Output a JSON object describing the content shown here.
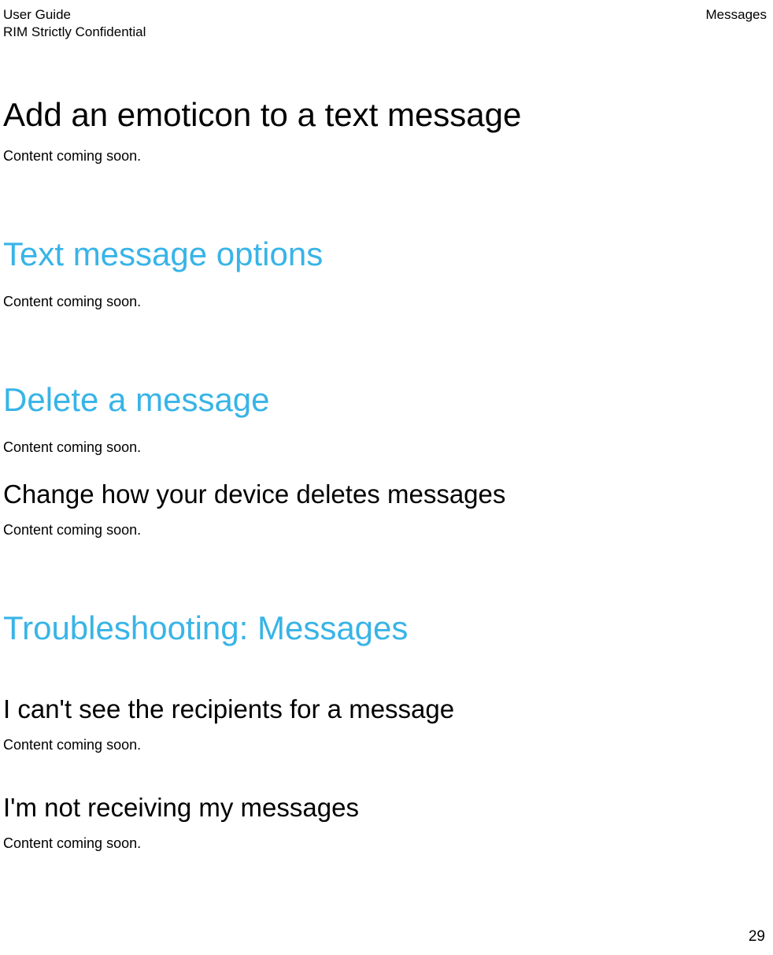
{
  "header": {
    "left1": "User Guide",
    "left2": "RIM Strictly Confidential",
    "right": "Messages"
  },
  "sections": {
    "s1": {
      "title": "Add an emoticon to a text message",
      "body": "Content coming soon."
    },
    "s2": {
      "title": "Text message options",
      "body": "Content coming soon."
    },
    "s3": {
      "title": "Delete a message",
      "body": "Content coming soon.",
      "sub": {
        "title": "Change how your device deletes messages",
        "body": "Content coming soon."
      }
    },
    "s4": {
      "title": "Troubleshooting: Messages",
      "sub1": {
        "title": "I can't see the recipients for a message",
        "body": "Content coming soon."
      },
      "sub2": {
        "title": "I'm not receiving my messages",
        "body": "Content coming soon."
      }
    }
  },
  "page_number": "29"
}
